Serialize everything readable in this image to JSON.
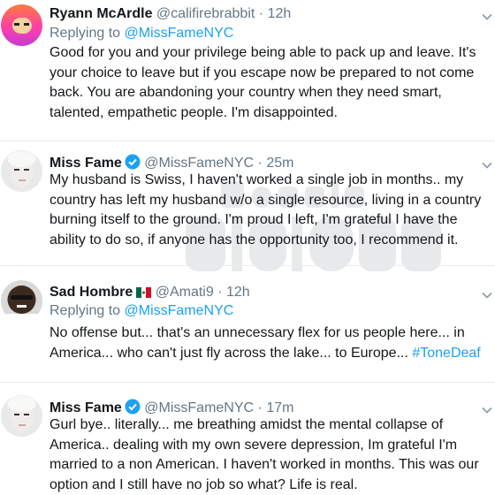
{
  "tweets": [
    {
      "name": "Ryann McArdle",
      "handle": "@califirebrabbit",
      "dot": "·",
      "time": "12h",
      "replying_prefix": "Replying to",
      "replying_to": "@MissFameNYC",
      "text": "Good for you and your privilege being able to pack up and leave. It's your choice to leave but if you escape now be prepared to not come back. You are abandoning your country when they need smart, talented, empathetic people. I'm disappointed."
    },
    {
      "name": "Miss Fame",
      "handle": "@MissFameNYC",
      "dot": "·",
      "time": "25m",
      "verified": true,
      "text": "My husband is Swiss, I haven't worked a single job in months.. my country has left my husband w/o a single resource, living in a country burning itself to the ground. I'm proud I left, I'm grateful I have the ability to do so, if anyone has the opportunity too, I recommend it."
    },
    {
      "name": "Sad Hombre",
      "flag": "mexico-flag",
      "handle": "@Amati9",
      "dot": "·",
      "time": "12h",
      "replying_prefix": "Replying to",
      "replying_to": "@MissFameNYC",
      "text": "No offense but... that's an unnecessary flex for us people here... in America... who can't just fly across the lake... to Europe...",
      "hashtag": "#ToneDeaf"
    },
    {
      "name": "Miss Fame",
      "handle": "@MissFameNYC",
      "dot": "·",
      "time": "17m",
      "verified": true,
      "text": "Gurl bye.. literally... me breathing amidst the mental collapse of America.. dealing with my own severe depression, Im grateful I'm married to a non American. I haven't worked in months. This was our option and I still have no job so what? Life is real."
    }
  ],
  "watermark": "Bossip",
  "colors": {
    "link": "#1da1f2",
    "secondary": "#657786",
    "text": "#14171a",
    "verified": "#1da1f2"
  }
}
